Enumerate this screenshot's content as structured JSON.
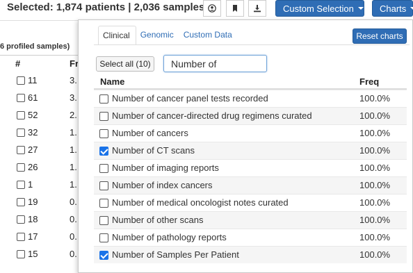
{
  "header": {
    "selected_text": "Selected: 1,874 patients | 2,036 samples",
    "icons": [
      "user-circle-icon",
      "bookmark-icon",
      "download-icon"
    ],
    "custom_selection_label": "Custom Selection",
    "charts_label": "Charts"
  },
  "background_table": {
    "subheader": "6 profiled samples)",
    "col_hash": "#",
    "col_fr": "Fr",
    "rows": [
      {
        "num": "11",
        "frac": "3."
      },
      {
        "num": "61",
        "frac": "3."
      },
      {
        "num": "52",
        "frac": "2."
      },
      {
        "num": "32",
        "frac": "1."
      },
      {
        "num": "27",
        "frac": "1."
      },
      {
        "num": "26",
        "frac": "1."
      },
      {
        "num": "1",
        "frac": "1."
      },
      {
        "num": "19",
        "frac": "0."
      },
      {
        "num": "18",
        "frac": "0."
      },
      {
        "num": "17",
        "frac": "0."
      },
      {
        "num": "15",
        "frac": "0."
      }
    ]
  },
  "panel": {
    "tabs": [
      "Clinical",
      "Genomic",
      "Custom Data"
    ],
    "active_tab": "Clinical",
    "reset_label": "Reset charts",
    "select_all_label": "Select all (10)",
    "search_value": "Number of",
    "col_name": "Name",
    "col_freq": "Freq",
    "items": [
      {
        "label": "Number of cancer panel tests recorded",
        "freq": "100.0%",
        "checked": false
      },
      {
        "label": "Number of cancer-directed drug regimens curated",
        "freq": "100.0%",
        "checked": false
      },
      {
        "label": "Number of cancers",
        "freq": "100.0%",
        "checked": false
      },
      {
        "label": "Number of CT scans",
        "freq": "100.0%",
        "checked": true
      },
      {
        "label": "Number of imaging reports",
        "freq": "100.0%",
        "checked": false
      },
      {
        "label": "Number of index cancers",
        "freq": "100.0%",
        "checked": false
      },
      {
        "label": "Number of medical oncologist notes curated",
        "freq": "100.0%",
        "checked": false
      },
      {
        "label": "Number of other scans",
        "freq": "100.0%",
        "checked": false
      },
      {
        "label": "Number of pathology reports",
        "freq": "100.0%",
        "checked": false
      },
      {
        "label": "Number of Samples Per Patient",
        "freq": "100.0%",
        "checked": true
      }
    ]
  },
  "colors": {
    "accent": "#2f6db5",
    "checkbox": "#1a73e8"
  }
}
